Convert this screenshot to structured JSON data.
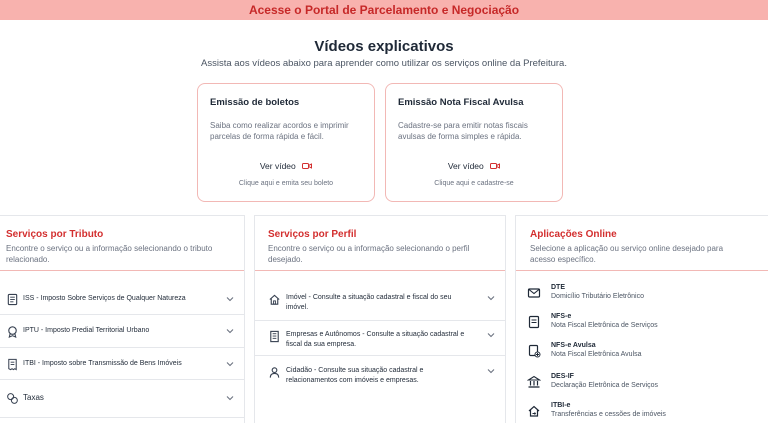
{
  "banner": {
    "text": "Acesse o Portal de Parcelamento e Negociação"
  },
  "videos": {
    "title": "Vídeos explicativos",
    "subtitle": "Assista aos vídeos abaixo para aprender como utilizar os serviços online da Prefeitura.",
    "cards": [
      {
        "title": "Emissão de boletos",
        "description": "Saiba como realizar acordos e imprimir parcelas de forma rápida e fácil.",
        "watch_label": "Ver vídeo",
        "footer": "Clique aqui e emita seu boleto"
      },
      {
        "title": "Emissão Nota Fiscal Avulsa",
        "description": "Cadastre-se para emitir notas fiscais avulsas de forma simples e rápida.",
        "watch_label": "Ver vídeo",
        "footer": "Clique aqui e cadastre-se"
      }
    ]
  },
  "tributo": {
    "title": "Serviços por Tributo",
    "subtitle": "Encontre o serviço ou a informação selecionando o tributo relacionado.",
    "items": [
      {
        "label": "ISS - Imposto Sobre Serviços de Qualquer Natureza",
        "icon": "document-icon"
      },
      {
        "label": "IPTU - Imposto Predial Territorial Urbano",
        "icon": "badge-icon"
      },
      {
        "label": "ITBI - Imposto sobre Transmissão de Bens Imóveis",
        "icon": "receipt-icon"
      },
      {
        "label": "Taxas",
        "icon": "coins-icon"
      }
    ]
  },
  "perfil": {
    "title": "Serviços por Perfil",
    "subtitle": "Encontre o serviço ou a informação selecionando o perfil desejado.",
    "items": [
      {
        "label": "Imóvel - Consulte a situação cadastral e fiscal do seu imóvel.",
        "icon": "house-icon"
      },
      {
        "label": "Empresas e Autônomos - Consulte a situação cadastral e fiscal da sua empresa.",
        "icon": "building-icon"
      },
      {
        "label": "Cidadão - Consulte sua situação cadastral e relacionamentos com imóveis e empresas.",
        "icon": "person-icon"
      }
    ]
  },
  "apps": {
    "title": "Aplicações Online",
    "subtitle": "Selecione a aplicação ou serviço online desejado para acesso específico.",
    "items": [
      {
        "name": "DTE",
        "desc": "Domicílio Tributário Eletrônico",
        "icon": "mail-icon"
      },
      {
        "name": "NFS-e",
        "desc": "Nota Fiscal Eletrônica de Serviços",
        "icon": "invoice-icon"
      },
      {
        "name": "NFS-e Avulsa",
        "desc": "Nota Fiscal Eletrônica Avulsa",
        "icon": "invoice-add-icon"
      },
      {
        "name": "DES-IF",
        "desc": "Declaração Eletrônica de Serviços",
        "icon": "bank-icon"
      },
      {
        "name": "ITBI-e",
        "desc": "Transferências e cessões de imóveis",
        "icon": "house-transfer-icon"
      }
    ]
  },
  "colors": {
    "accent": "#d32f2f",
    "banner_bg": "#f8b2ae",
    "card_border": "#f2b8b5"
  }
}
